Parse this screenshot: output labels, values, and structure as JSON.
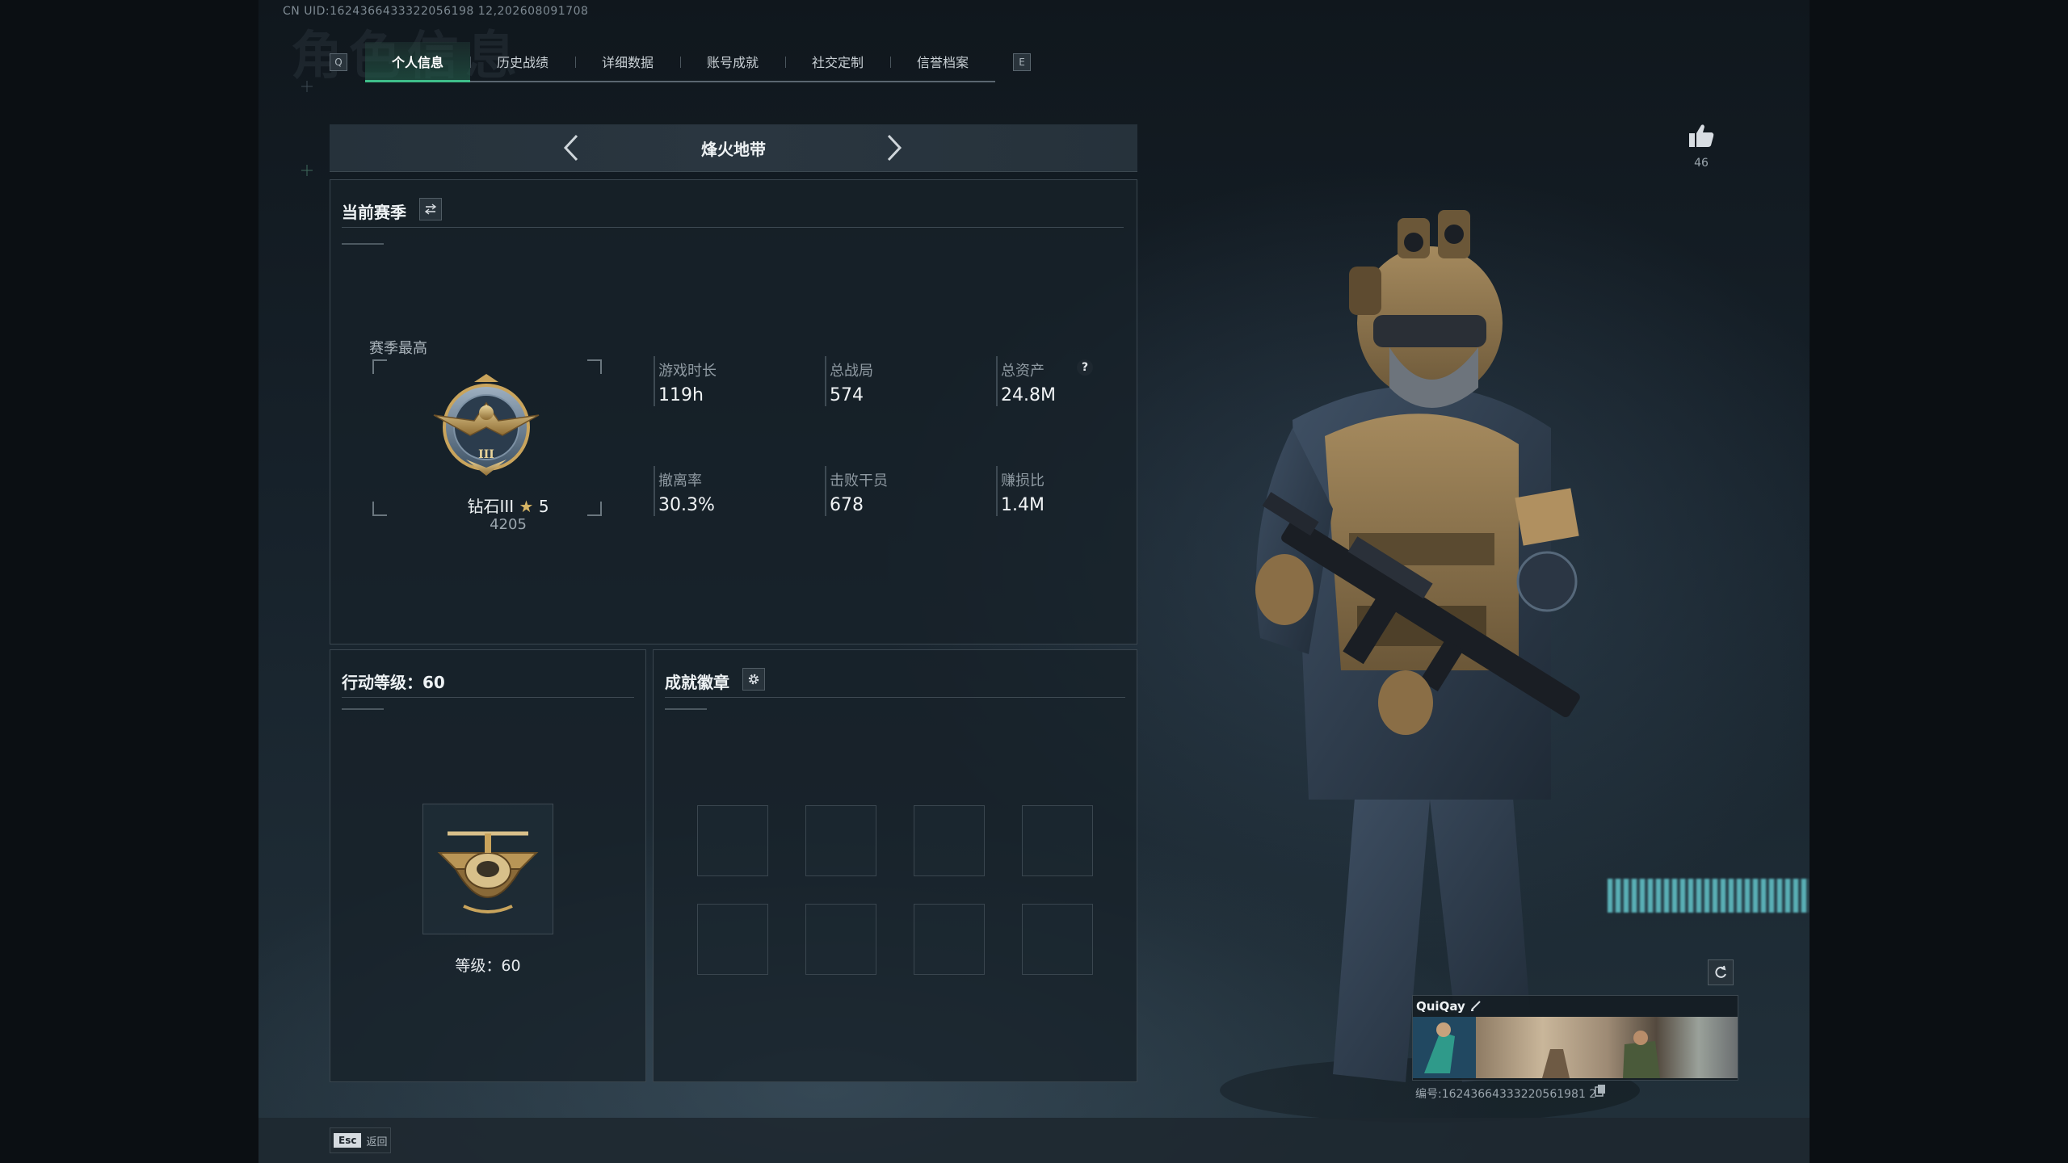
{
  "uid_text": "CN UID:1624366433322056198 12,202608091708",
  "ghost_title": "角色信息",
  "tabs": {
    "left_key": "Q",
    "right_key": "E",
    "items": [
      "个人信息",
      "历史战绩",
      "详细数据",
      "账号成就",
      "社交定制",
      "信誉档案"
    ],
    "active": "个人信息"
  },
  "mode": {
    "title": "烽火地带"
  },
  "season": {
    "title": "当前赛季",
    "best_label": "赛季最高",
    "rank_name": "钻石III",
    "rank_stars": "5",
    "rank_score": "4205",
    "stats": [
      {
        "label": "游戏时长",
        "value": "119h"
      },
      {
        "label": "总战局",
        "value": "574"
      },
      {
        "label": "总资产",
        "value": "24.8M",
        "help": "?"
      },
      {
        "label": "撤离率",
        "value": "30.3%"
      },
      {
        "label": "击败干员",
        "value": "678"
      },
      {
        "label": "赚损比",
        "value": "1.4M"
      }
    ]
  },
  "action_level": {
    "title": "行动等级：60",
    "level_text": "等级：60"
  },
  "achievements": {
    "title": "成就徽章",
    "slots": 8
  },
  "likes": {
    "count": "46",
    "icon": "thumbs-up-icon"
  },
  "player_card": {
    "name": "QuiQay",
    "id_text": "编号:16243664333220561981 2"
  },
  "footer": {
    "esc_key": "Esc",
    "back_label": "返回"
  },
  "colors": {
    "accent": "#3fbf8a",
    "panel": "#172129",
    "gold": "#c9a45c"
  }
}
